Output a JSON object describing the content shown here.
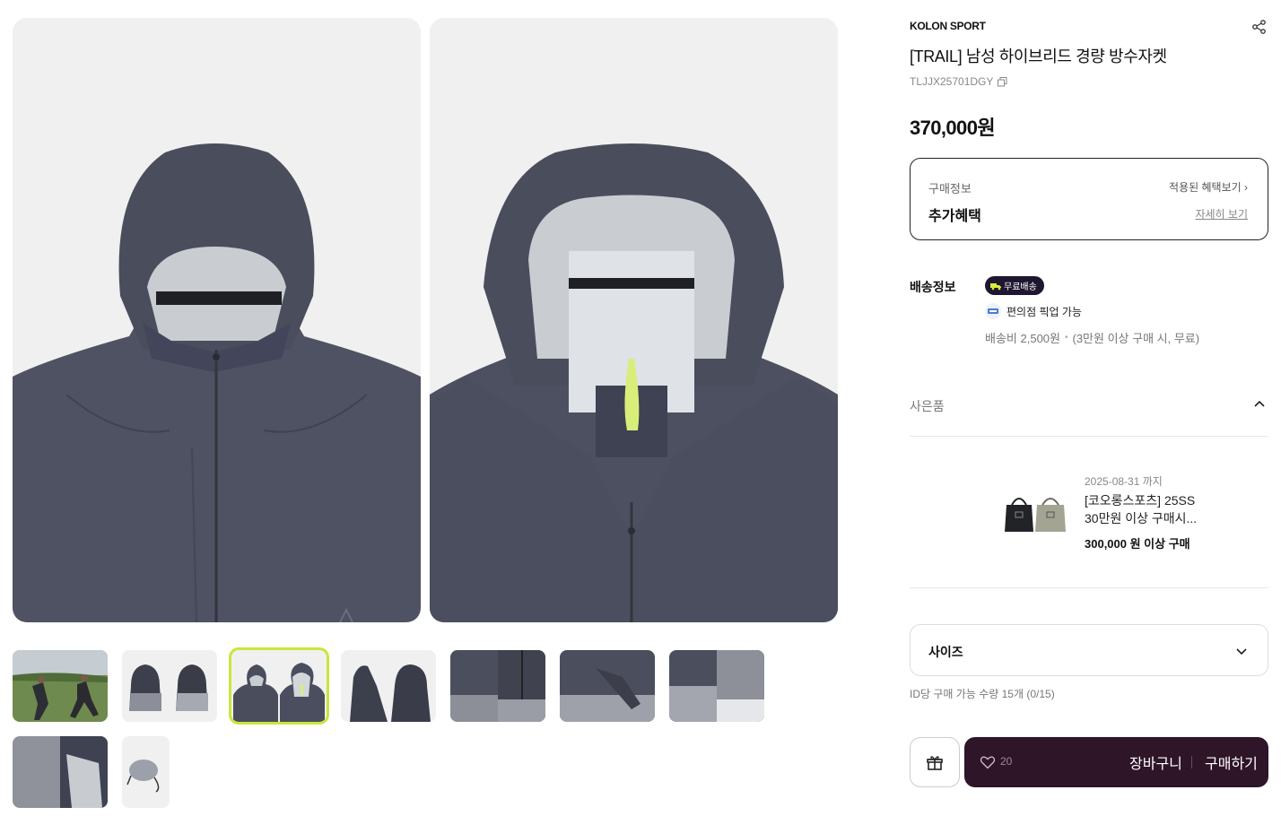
{
  "product": {
    "brand": "KOLON SPORT",
    "title": "[TRAIL] 남성 하이브리드 경량 방수자켓",
    "sku": "TLJJX25701DGY",
    "price": "370,000원"
  },
  "purchase_info": {
    "label": "구매정보",
    "benefits_link": "적용된 혜택보기 ›",
    "extra_title": "추가혜택",
    "detail_link": "자세히 보기"
  },
  "shipping": {
    "label": "배송정보",
    "badge": "무료배송",
    "pickup": "편의점 픽업 가능",
    "fee": "배송비 2,500원",
    "condition": "(3만원 이상 구매 시, 무료)"
  },
  "gift": {
    "header": "사은품",
    "date": "2025-08-31 까지",
    "name": "[코오롱스포츠] 25SS 30만원 이상 구매시...",
    "condition": "300,000 원 이상 구매"
  },
  "size": {
    "label": "사이즈",
    "limit": "ID당 구매 가능 수량 15개 (0/15)"
  },
  "actions": {
    "like_count": "20",
    "cart": "장바구니",
    "buy": "구매하기"
  },
  "gallery": {
    "selected_index": 2,
    "thumbnail_count": 9
  },
  "colors": {
    "buy_bar": "#2e1528",
    "badge": "#1f1630",
    "accent": "#c8e63a",
    "jacket": "#4d5060"
  }
}
